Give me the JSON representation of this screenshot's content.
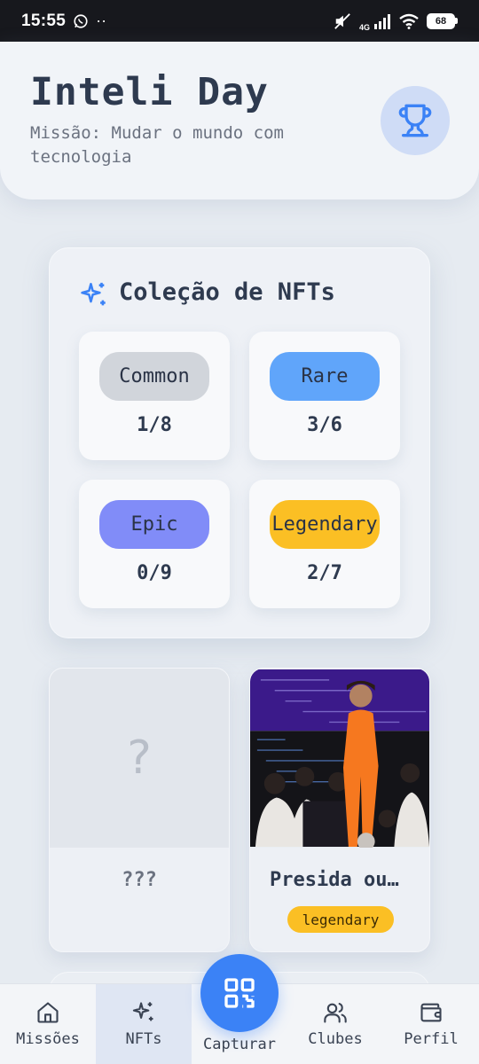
{
  "status_bar": {
    "time": "15:55",
    "network": "4G",
    "battery": "68"
  },
  "header": {
    "title": "Inteli Day",
    "subtitle": "Missão: Mudar o mundo com tecnologia",
    "trophy_icon": "trophy-icon"
  },
  "collection": {
    "title": "Coleção de NFTs",
    "icon": "sparkles-icon",
    "rarities": [
      {
        "label": "Common",
        "count": "1/8",
        "color": "#d1d5db"
      },
      {
        "label": "Rare",
        "count": "3/6",
        "color": "#60a5fa"
      },
      {
        "label": "Epic",
        "count": "0/9",
        "color": "#818cf8"
      },
      {
        "label": "Legendary",
        "count": "2/7",
        "color": "#fbbf24"
      }
    ]
  },
  "nfts": [
    {
      "placeholder": "?",
      "name": "???"
    },
    {
      "name": "Presida ou…",
      "rarity": "legendary"
    }
  ],
  "bottom_nav": {
    "items": [
      {
        "label": "Missões",
        "icon": "home-icon"
      },
      {
        "label": "NFTs",
        "icon": "sparkles-icon"
      },
      {
        "label": "Capturar",
        "icon": "qr-code-icon"
      },
      {
        "label": "Clubes",
        "icon": "users-icon"
      },
      {
        "label": "Perfil",
        "icon": "wallet-icon"
      }
    ],
    "active": "NFTs",
    "accent": "#3b82f6"
  }
}
